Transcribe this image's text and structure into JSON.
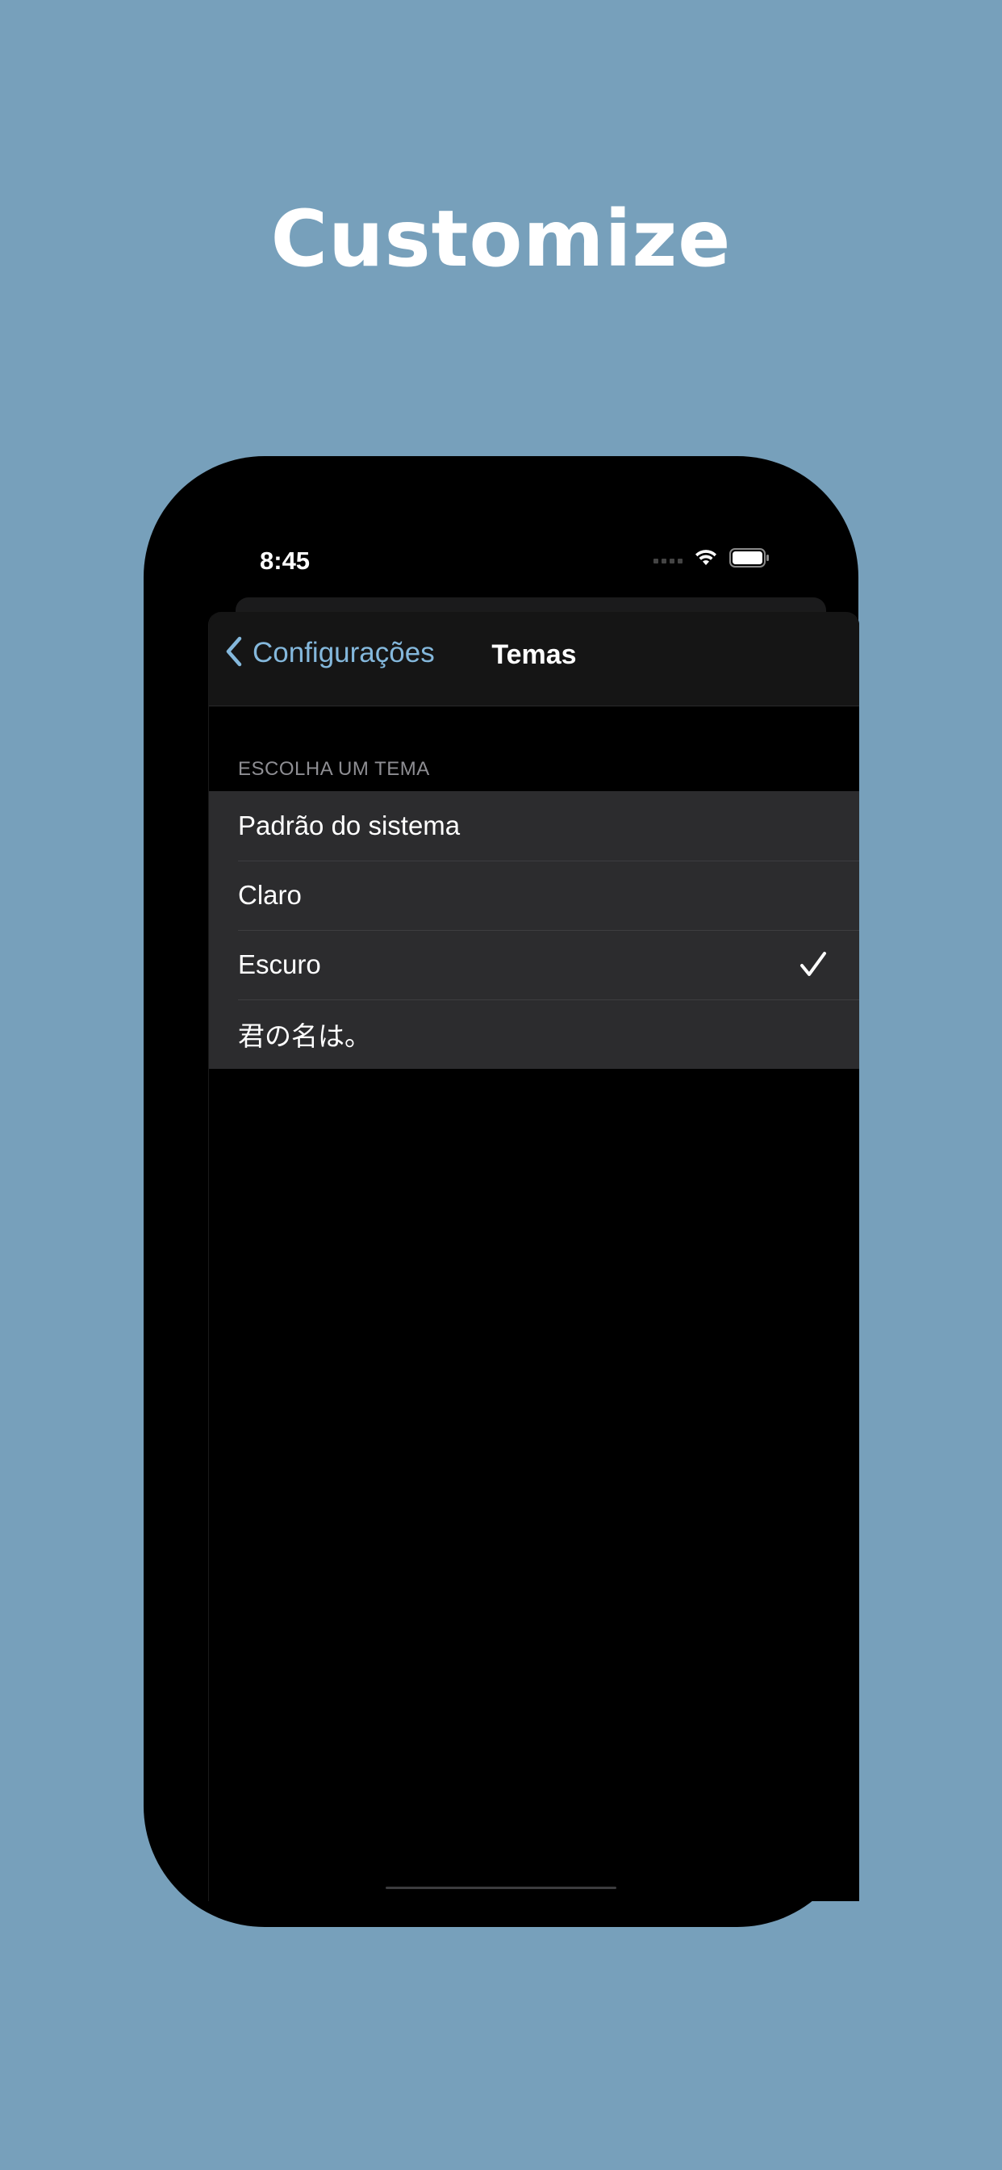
{
  "headline": "Customize",
  "status_bar": {
    "time": "8:45",
    "icons": [
      "signal-icon",
      "wifi-icon",
      "battery-icon"
    ]
  },
  "navbar": {
    "back_label": "Configurações",
    "back_icon": "chevron-left-icon",
    "title": "Temas"
  },
  "section": {
    "header": "ESCOLHA UM TEMA",
    "options": [
      {
        "label": "Padrão do sistema",
        "selected": false
      },
      {
        "label": "Claro",
        "selected": false
      },
      {
        "label": "Escuro",
        "selected": true
      },
      {
        "label": "君の名は。",
        "selected": false
      }
    ]
  },
  "colors": {
    "background": "#77a0bb",
    "accent": "#84b8dc",
    "list_bg": "#2c2c2e"
  }
}
